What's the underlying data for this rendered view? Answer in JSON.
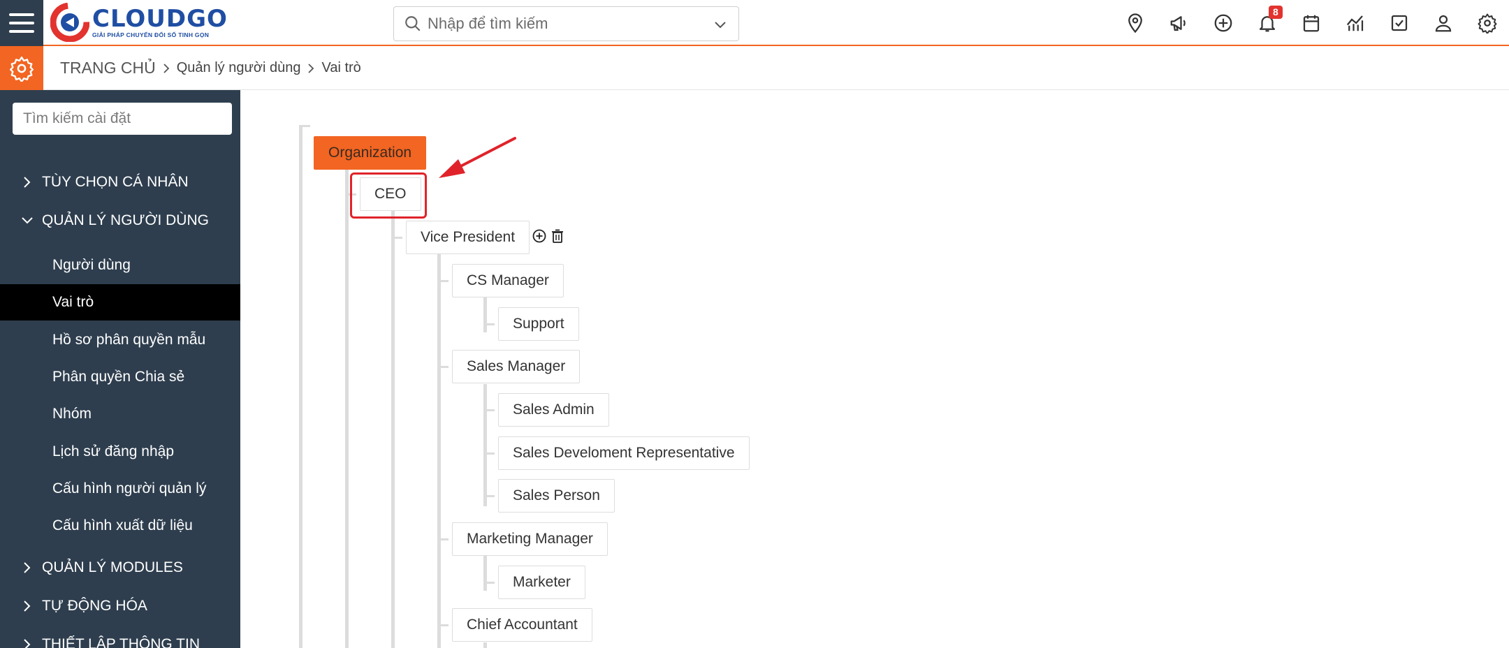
{
  "header": {
    "logo": {
      "name": "CLOUDGO",
      "tagline": "GIẢI PHÁP CHUYỂN ĐỔI SỐ TINH GỌN"
    },
    "search": {
      "placeholder": "Nhập để tìm kiếm"
    },
    "icons": [
      "location-icon",
      "megaphone-icon",
      "add-circle-icon",
      "bell-icon",
      "calendar-icon",
      "chart-icon",
      "checkbox-icon",
      "user-icon",
      "settings-icon"
    ],
    "notification_count": "8"
  },
  "breadcrumb": {
    "home": "TRANG CHỦ",
    "items": [
      "Quản lý người dùng",
      "Vai trò"
    ]
  },
  "sidebar": {
    "search_placeholder": "Tìm kiếm cài đặt",
    "sections": [
      {
        "label": "TÙY CHỌN CÁ NHÂN",
        "expanded": false
      },
      {
        "label": "QUẢN LÝ NGƯỜI DÙNG",
        "expanded": true
      },
      {
        "label": "QUẢN LÝ MODULES",
        "expanded": false
      },
      {
        "label": "TỰ ĐỘNG HÓA",
        "expanded": false
      },
      {
        "label": "THIẾT LẬP THÔNG TIN",
        "expanded": false
      }
    ],
    "items": [
      "Người dùng",
      "Vai trò",
      "Hồ sơ phân quyền mẫu",
      "Phân quyền Chia sẻ",
      "Nhóm",
      "Lịch sử đăng nhập",
      "Cấu hình người quản lý",
      "Cấu hình xuất dữ liệu"
    ],
    "active_item": "Vai trò"
  },
  "tree": {
    "root": "Organization",
    "ceo": "CEO",
    "vp": "Vice President",
    "cs_manager": "CS Manager",
    "support": "Support",
    "sales_manager": "Sales Manager",
    "sales_admin": "Sales Admin",
    "sales_dev": "Sales Develoment Representative",
    "sales_person": "Sales Person",
    "marketing_manager": "Marketing Manager",
    "marketer": "Marketer",
    "chief_accountant": "Chief Accountant"
  },
  "colors": {
    "accent": "#f26522",
    "sidebar": "#2e3e4e",
    "highlight": "#e0232a",
    "brand": "#1f4ea3"
  }
}
